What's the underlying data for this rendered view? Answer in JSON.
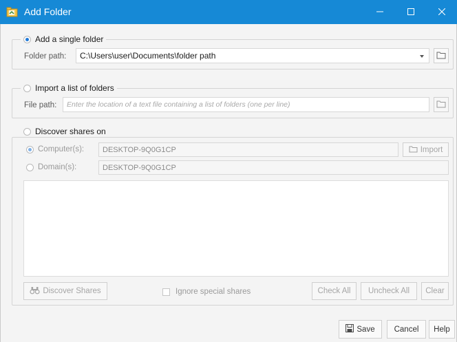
{
  "window": {
    "title": "Add Folder"
  },
  "single_folder": {
    "option_label": "Add a single folder",
    "selected": true,
    "path_label": "Folder path:",
    "path_value": "C:\\Users\\user\\Documents\\folder path"
  },
  "import_list": {
    "option_label": "Import a list of folders",
    "selected": false,
    "path_label": "File path:",
    "path_placeholder": "Enter the location of a text file containing a list of folders (one per line)"
  },
  "discover": {
    "option_label": "Discover shares on",
    "selected": false,
    "computer_label": "Computer(s):",
    "computer_value": "DESKTOP-9Q0G1CP",
    "domain_label": "Domain(s):",
    "domain_value": "DESKTOP-9Q0G1CP",
    "import_label": "Import",
    "discover_label": "Discover Shares",
    "ignore_label": "Ignore special shares",
    "check_all_label": "Check All",
    "uncheck_all_label": "Uncheck All",
    "clear_label": "Clear"
  },
  "footer": {
    "save_label": "Save",
    "cancel_label": "Cancel",
    "help_label": "Help"
  },
  "colors": {
    "title_bar": "#1689d6",
    "radio_selected": "#1f79d8"
  },
  "icons": [
    "app-folder-icon",
    "minimize-icon",
    "maximize-icon",
    "close-icon",
    "dropdown-arrow-icon",
    "browse-folder-icon",
    "import-folder-icon",
    "binoculars-icon",
    "save-disk-icon"
  ]
}
